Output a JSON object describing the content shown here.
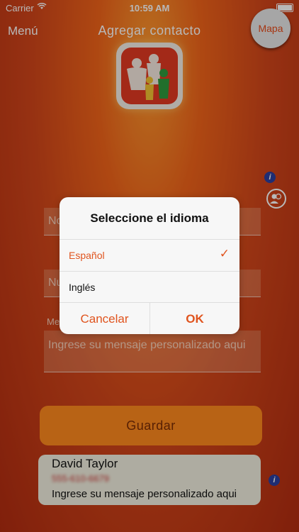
{
  "status": {
    "carrier": "Carrier",
    "time": "10:59 AM"
  },
  "nav": {
    "menu_label": "Menú",
    "title": "Agregar contacto",
    "map_label": "Mapa"
  },
  "form": {
    "name_placeholder": "No",
    "number_placeholder": "Nu",
    "message_label": "Me",
    "message_placeholder": "Ingrese su mensaje personalizado aqui"
  },
  "save_label": "Guardar",
  "contact_card": {
    "name": "David Taylor",
    "phone": "555-610-6679",
    "message": "Ingrese su mensaje personalizado aqui"
  },
  "dialog": {
    "title": "Seleccione el idioma",
    "options": [
      {
        "label": "Español",
        "selected": true
      },
      {
        "label": "Inglés",
        "selected": false
      }
    ],
    "cancel_label": "Cancelar",
    "ok_label": "OK"
  },
  "colors": {
    "accent": "#e0541e",
    "background": "#d2461a",
    "button": "#ff8a1e"
  },
  "icons": {
    "info": "info-icon",
    "contacts": "contacts-icon",
    "check": "checkmark-icon",
    "wifi": "wifi-icon",
    "battery": "battery-icon"
  }
}
